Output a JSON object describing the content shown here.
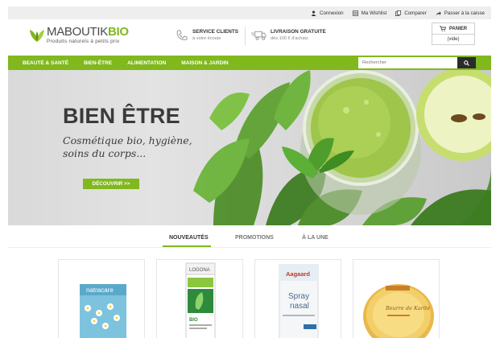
{
  "topbar": {
    "links": [
      {
        "label": "Connexion",
        "icon": "user-icon"
      },
      {
        "label": "Ma Wishlist",
        "icon": "list-icon"
      },
      {
        "label": "Comparer",
        "icon": "compare-icon"
      },
      {
        "label": "Passer à la caisse",
        "icon": "checkout-arrow-icon"
      }
    ]
  },
  "header": {
    "logo_part1": "MABOUTIK",
    "logo_part2": "BIO",
    "tagline": "Produits naturels à petits prix",
    "service_title": "SERVICE CLIENTS",
    "service_sub": "à votre écoute",
    "delivery_title": "LIVRAISON GRATUITE",
    "delivery_sub": "dès 100 € d'achats",
    "cart_label": "PANIER",
    "cart_status": "(vide)"
  },
  "nav": {
    "items": [
      "BEAUTÉ & SANTÉ",
      "BIEN-ÊTRE",
      "ALIMENTATION",
      "MAISON & JARDIN"
    ],
    "search_placeholder": "Rechercher"
  },
  "hero": {
    "title": "BIEN ÊTRE",
    "subtitle": "Cosmétique bio, hygiène, soins du corps...",
    "button": "DÉCOUVRIR >>"
  },
  "tabs": {
    "items": [
      "NOUVEAUTÉS",
      "PROMOTIONS",
      "À LA UNE"
    ],
    "active": "NOUVEAUTÉS"
  },
  "products": {
    "p1_brand": "natracare",
    "p2_brand": "LOGONA",
    "p2_line": "BIO",
    "p3_brand": "Aagaard",
    "p3_line1": "Spray",
    "p3_line2": "nasal",
    "p4_line1": "Beurre de Karité"
  },
  "colors": {
    "accent": "#80b81e",
    "dark": "#2b2b2b",
    "topbar_bg": "#eeeeee"
  }
}
